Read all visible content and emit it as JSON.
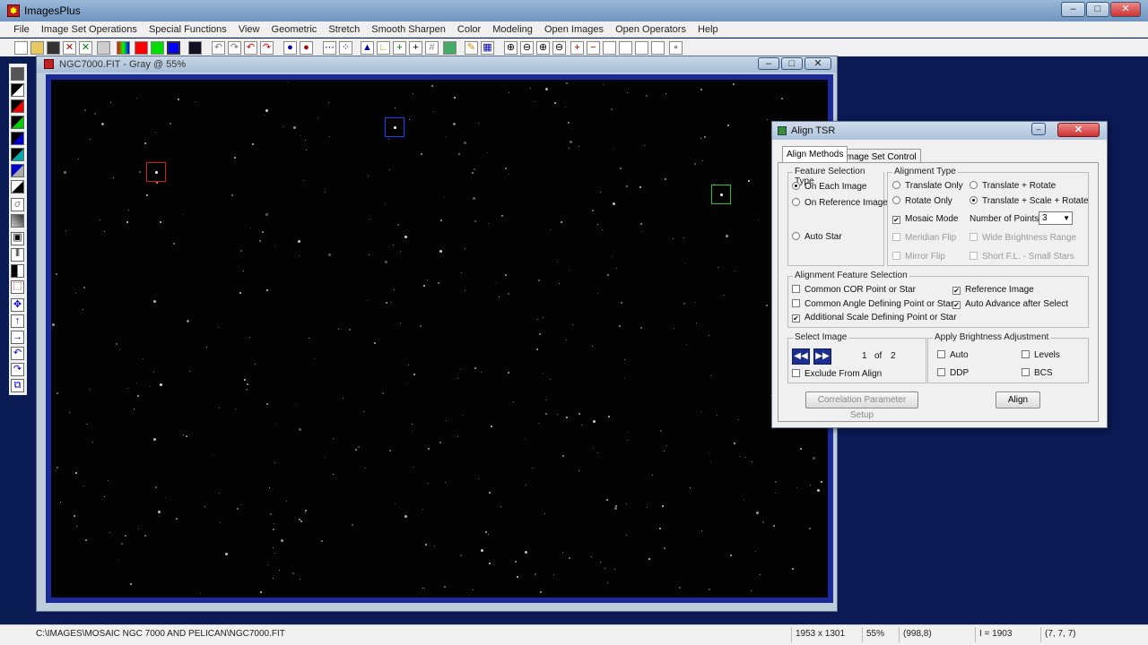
{
  "app": {
    "title": "ImagesPlus",
    "icon": "imagesplus-logo-icon"
  },
  "menu": [
    "File",
    "Image Set Operations",
    "Special Functions",
    "View",
    "Geometric",
    "Stretch",
    "Smooth Sharpen",
    "Color",
    "Modeling",
    "Open Images",
    "Open Operators",
    "Help"
  ],
  "image_window": {
    "title": "NGC7000.FIT - Gray @ 55%"
  },
  "dialog": {
    "title": "Align TSR",
    "tabs": [
      "Align Methods",
      "Image Set Control"
    ],
    "feature_selection_type": {
      "label": "Feature Selection Type",
      "options": [
        "On Each Image",
        "On Reference Image",
        "Auto Star"
      ],
      "selected": "On Each Image"
    },
    "alignment_type": {
      "label": "Alignment Type",
      "options": [
        "Translate Only",
        "Translate + Rotate",
        "Rotate Only",
        "Translate + Scale + Rotate"
      ],
      "selected": "Translate + Scale + Rotate"
    },
    "mosaic_mode": {
      "label": "Mosaic Mode",
      "checked": true
    },
    "number_of_points": {
      "label": "Number of Points:",
      "value": "3"
    },
    "meridian_flip": "Meridian Flip",
    "wide_brightness": "Wide Brightness Range",
    "mirror_flip": "Mirror Flip",
    "short_fl": "Short F.L. - Small Stars",
    "feature_selection": {
      "label": "Alignment Feature Selection",
      "common_cor": "Common COR Point or Star",
      "common_angle": "Common Angle Defining Point or Star",
      "additional_scale": "Additional Scale Defining Point or Star",
      "reference_image": "Reference Image",
      "auto_advance": "Auto Advance after Select"
    },
    "select_image": {
      "label": "Select Image",
      "current": "1",
      "of": "of",
      "total": "2",
      "exclude": "Exclude From Align"
    },
    "brightness": {
      "label": "Apply Brightness Adjustment",
      "auto": "Auto",
      "levels": "Levels",
      "ddp": "DDP",
      "bcs": "BCS"
    },
    "buttons": {
      "correlation": "Correlation Parameter Setup",
      "align": "Align"
    }
  },
  "status": {
    "path": "C:\\IMAGES\\MOSAIC NGC 7000 AND PELICAN\\NGC7000.FIT",
    "dimensions": "1953 x 1301",
    "zoom": "55%",
    "coords": "(998,8)",
    "intensity": "I = 1903",
    "rgb": "(7, 7, 7)"
  },
  "colors": {
    "accent_blue": "#1a2a9a",
    "red_box": "#d02020",
    "blue_box": "#2040ff",
    "green_box": "#30c030"
  }
}
